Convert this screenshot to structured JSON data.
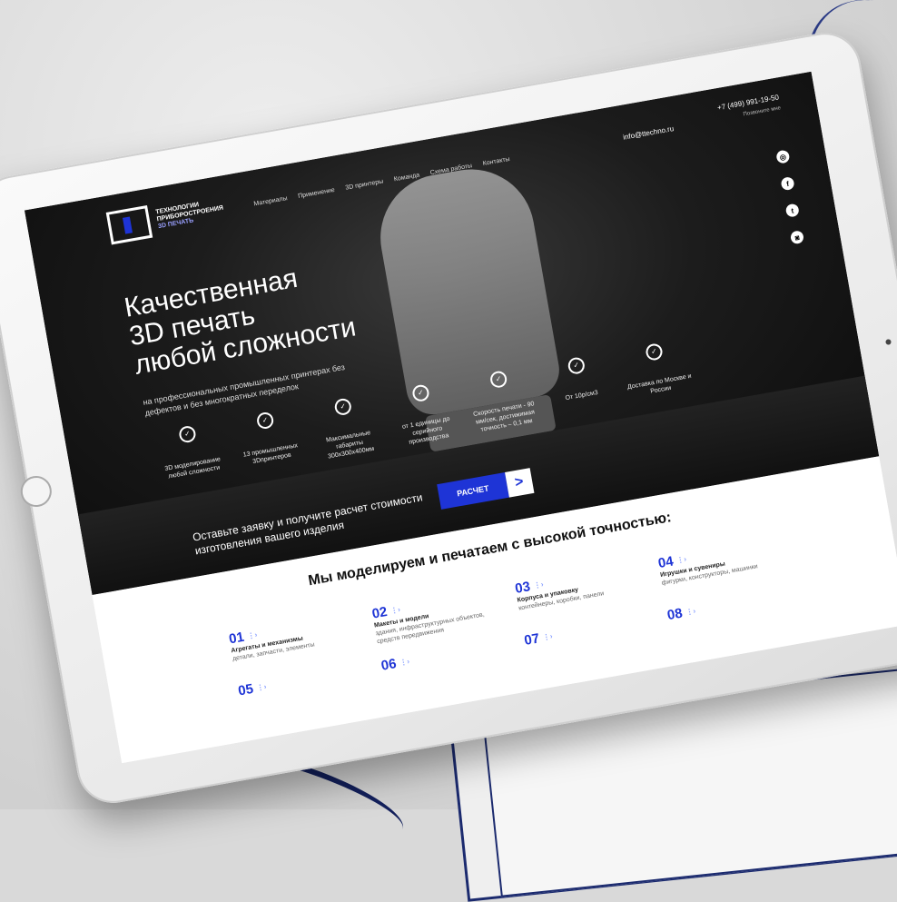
{
  "header": {
    "brand_line1": "ТЕХНОЛОГИИ",
    "brand_line2": "ПРИБОРОСТРОЕНИЯ",
    "brand_line3": "3D ПЕЧАТЬ",
    "nav": [
      "Материалы",
      "Применение",
      "3D принтеры",
      "Команда",
      "Схема работы",
      "Контакты"
    ],
    "email": "info@ttechno.ru",
    "phone": "+7 (499) 991-19-50",
    "callback": "Позвоните мне"
  },
  "social_icons": [
    "social-icon-1",
    "facebook-icon",
    "twitter-icon",
    "instagram-icon"
  ],
  "hero": {
    "title_line1": "Качественная",
    "title_line2": "3D печать",
    "title_line3": "любой сложности",
    "subtitle": "на профессиональных промышленных принтерах без дефектов и без многократных переделок"
  },
  "features": [
    {
      "text": "3D моделирование любой сложности"
    },
    {
      "text": "13 промышленных 3Dпринтеров"
    },
    {
      "text": "Максимальные габариты 300х300х400мм"
    },
    {
      "text": "от 1 единицы до серийного производства"
    },
    {
      "text": "Скорость печати - 90 мм/сек, достижимая точность – 0,1 мм"
    },
    {
      "text": "От 10р/см3"
    },
    {
      "text": "Доставка по Москве и России"
    }
  ],
  "cta": {
    "text": "Оставьте заявку и получите расчет стоимости изготовления вашего изделия",
    "button": "РАСЧЕТ",
    "button_arrow": ">"
  },
  "section": {
    "title": "Мы моделируем и печатаем с высокой точностью:",
    "items": [
      {
        "num": "01",
        "title": "Агрегаты и механизмы",
        "desc": "детали, запчасти, элементы"
      },
      {
        "num": "02",
        "title": "Макеты и модели",
        "desc": "здания, инфраструктурных объектов, средств передвижения"
      },
      {
        "num": "03",
        "title": "Корпуса и упаковку",
        "desc": "контейнеры, коробки, панели"
      },
      {
        "num": "04",
        "title": "Игрушки и сувениры",
        "desc": "фигурки, конструкторы, машинки"
      },
      {
        "num": "05",
        "title": "",
        "desc": ""
      },
      {
        "num": "06",
        "title": "",
        "desc": ""
      },
      {
        "num": "07",
        "title": "",
        "desc": ""
      },
      {
        "num": "08",
        "title": "",
        "desc": ""
      }
    ]
  },
  "colors": {
    "accent": "#1e34d6",
    "dark": "#111111",
    "paper_ink": "#1b2a6e"
  }
}
